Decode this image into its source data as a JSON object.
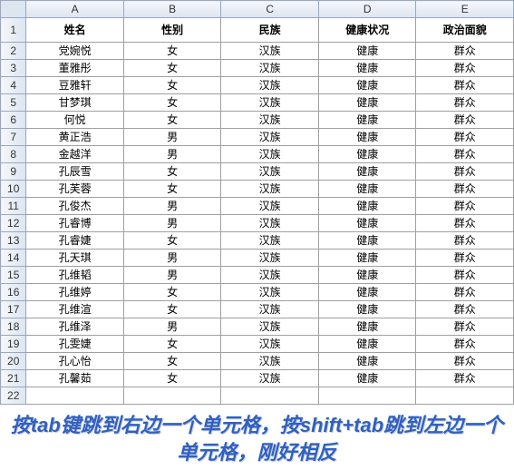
{
  "columns": [
    "A",
    "B",
    "C",
    "D",
    "E"
  ],
  "headers": [
    "姓名",
    "性别",
    "民族",
    "健康状况",
    "政治面貌"
  ],
  "rows": [
    {
      "n": "党婉悦",
      "s": "女",
      "e": "汉族",
      "h": "健康",
      "p": "群众"
    },
    {
      "n": "董雅彤",
      "s": "女",
      "e": "汉族",
      "h": "健康",
      "p": "群众"
    },
    {
      "n": "豆雅轩",
      "s": "女",
      "e": "汉族",
      "h": "健康",
      "p": "群众"
    },
    {
      "n": "甘梦琪",
      "s": "女",
      "e": "汉族",
      "h": "健康",
      "p": "群众"
    },
    {
      "n": "何悦",
      "s": "女",
      "e": "汉族",
      "h": "健康",
      "p": "群众"
    },
    {
      "n": "黄正浩",
      "s": "男",
      "e": "汉族",
      "h": "健康",
      "p": "群众"
    },
    {
      "n": "金越洋",
      "s": "男",
      "e": "汉族",
      "h": "健康",
      "p": "群众"
    },
    {
      "n": "孔辰雪",
      "s": "女",
      "e": "汉族",
      "h": "健康",
      "p": "群众"
    },
    {
      "n": "孔芙蓉",
      "s": "女",
      "e": "汉族",
      "h": "健康",
      "p": "群众"
    },
    {
      "n": "孔俊杰",
      "s": "男",
      "e": "汉族",
      "h": "健康",
      "p": "群众"
    },
    {
      "n": "孔睿博",
      "s": "男",
      "e": "汉族",
      "h": "健康",
      "p": "群众"
    },
    {
      "n": "孔睿婕",
      "s": "女",
      "e": "汉族",
      "h": "健康",
      "p": "群众"
    },
    {
      "n": "孔天琪",
      "s": "男",
      "e": "汉族",
      "h": "健康",
      "p": "群众"
    },
    {
      "n": "孔维韬",
      "s": "男",
      "e": "汉族",
      "h": "健康",
      "p": "群众"
    },
    {
      "n": "孔维婷",
      "s": "女",
      "e": "汉族",
      "h": "健康",
      "p": "群众"
    },
    {
      "n": "孔维渲",
      "s": "女",
      "e": "汉族",
      "h": "健康",
      "p": "群众"
    },
    {
      "n": "孔维泽",
      "s": "男",
      "e": "汉族",
      "h": "健康",
      "p": "群众"
    },
    {
      "n": "孔雯婕",
      "s": "女",
      "e": "汉族",
      "h": "健康",
      "p": "群众"
    },
    {
      "n": "孔心怡",
      "s": "女",
      "e": "汉族",
      "h": "健康",
      "p": "群众"
    },
    {
      "n": "孔馨茹",
      "s": "女",
      "e": "汉族",
      "h": "健康",
      "p": "群众"
    }
  ],
  "hint": "按tab键跳到右边一个单元格，按shift+tab跳到左边一个单元格，刚好相反"
}
